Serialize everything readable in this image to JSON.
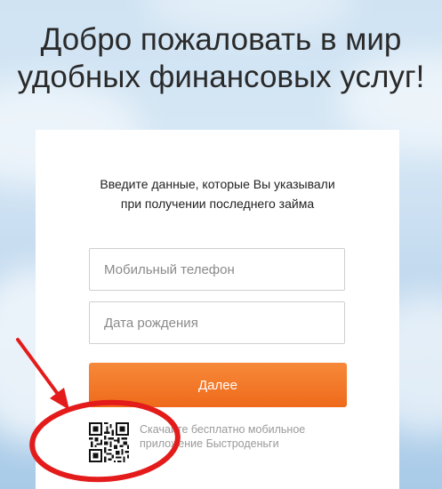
{
  "headline": {
    "line1": "Добро пожаловать в мир",
    "line2": "удобных финансовых услуг!"
  },
  "form": {
    "intro_line1": "Введите данные, которые Вы указывали",
    "intro_line2": "при получении последнего займа",
    "phone_placeholder": "Мобильный телефон",
    "birthdate_placeholder": "Дата рождения",
    "submit_label": "Далее"
  },
  "app_promo": {
    "line1": "Скачайте бесплатно мобильное",
    "line2": "приложение Быстроденьги"
  },
  "colors": {
    "accent": "#f07423",
    "annotation": "#e41b1b",
    "headline_text": "#2a2a2a"
  }
}
